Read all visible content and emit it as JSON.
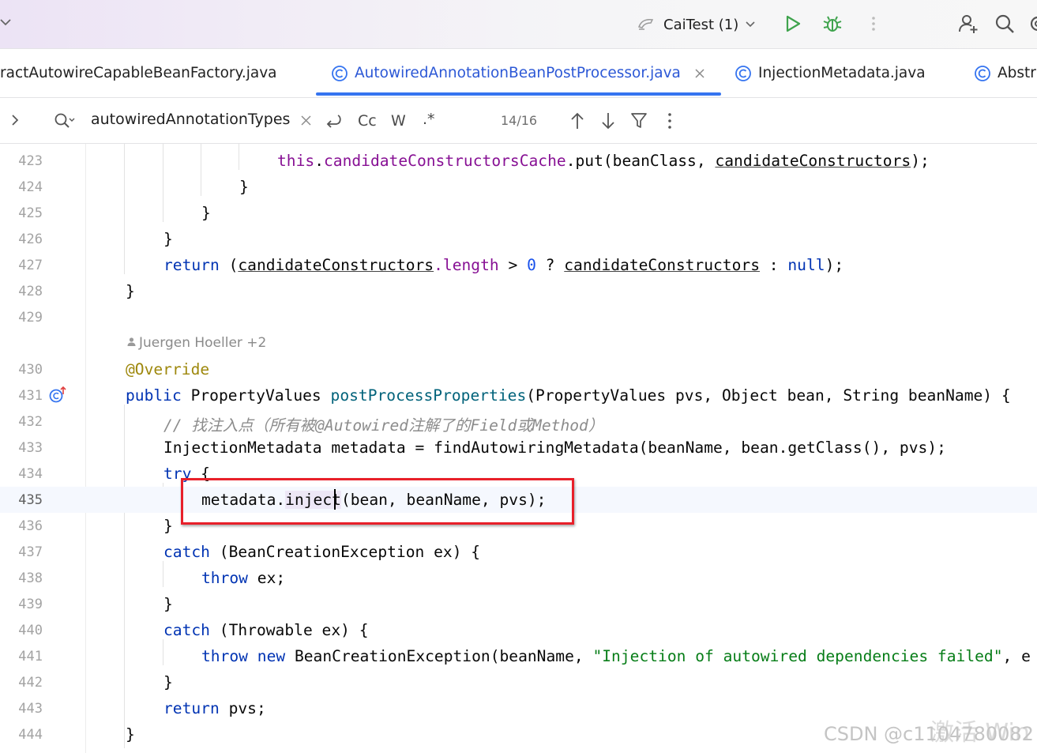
{
  "toolbar": {
    "run_config": "CaiTest (1)"
  },
  "tabs": [
    {
      "label": "ractAutowireCapableBeanFactory.java"
    },
    {
      "label": "AutowiredAnnotationBeanPostProcessor.java"
    },
    {
      "label": "InjectionMetadata.java"
    },
    {
      "label": "Abstr"
    }
  ],
  "find": {
    "query": "autowiredAnnotationTypes",
    "match_case": "Cc",
    "words": "W",
    "regex": ".*",
    "count": "14/16"
  },
  "editor": {
    "author_hint": "Juergen Hoeller +2",
    "line_numbers": [
      "423",
      "424",
      "425",
      "426",
      "427",
      "428",
      "429",
      "430",
      "431",
      "432",
      "433",
      "434",
      "435",
      "436",
      "437",
      "438",
      "439",
      "440",
      "441",
      "442",
      "443",
      "444"
    ],
    "current_line": "435",
    "lines": {
      "l423": {
        "kw": "this",
        "a": ".",
        "fld": "candidateConstructorsCache",
        "b": ".put(beanClass, ",
        "u": "candidateConstructors",
        "c": ");"
      },
      "l424": "}",
      "l425": "}",
      "l426": "}",
      "l427": {
        "kw": "return",
        "a": " (",
        "u1": "candidateConstructors",
        "fld": ".length",
        "b": " > ",
        "num": "0",
        "c": " ? ",
        "u2": "candidateConstructors",
        "d": " : ",
        "kw2": "null",
        "e": ");"
      },
      "l428": "}",
      "l430": "@Override",
      "l431": {
        "kw": "public",
        "a": " PropertyValues ",
        "mth": "postProcessProperties",
        "b": "(PropertyValues pvs, Object bean, String beanName) {"
      },
      "l432": "// 找注入点（所有被@Autowired注解了的Field或Method）",
      "l433": "InjectionMetadata metadata = findAutowiringMetadata(beanName, bean.getClass(), pvs);",
      "l434": {
        "kw": "try",
        "a": " {"
      },
      "l435": {
        "a": "metadata.",
        "hl": "inject",
        "b": "(bean, beanName, pvs);"
      },
      "l436": "}",
      "l437": {
        "kw": "catch",
        "a": " (BeanCreationException ex) {"
      },
      "l438": {
        "kw": "throw",
        "a": " ex;"
      },
      "l439": "}",
      "l440": {
        "kw": "catch",
        "a": " (Throwable ex) {"
      },
      "l441": {
        "kw": "throw",
        "kw2": "new",
        "a": " BeanCreationException(beanName, ",
        "str": "\"Injection of autowired dependencies failed\"",
        "b": ", e"
      },
      "l442": "}",
      "l443": {
        "kw": "return",
        "a": " pvs;"
      },
      "l444": "}"
    }
  },
  "watermark": "CSDN @c1104780082",
  "watermark_overlay": "激活 Win",
  "colors": {
    "keyword": "#0033b3",
    "field": "#871094",
    "string": "#067d17",
    "annotation": "#9e880d",
    "highlight_box": "#e8202a",
    "active_tab": "#3574f0"
  }
}
